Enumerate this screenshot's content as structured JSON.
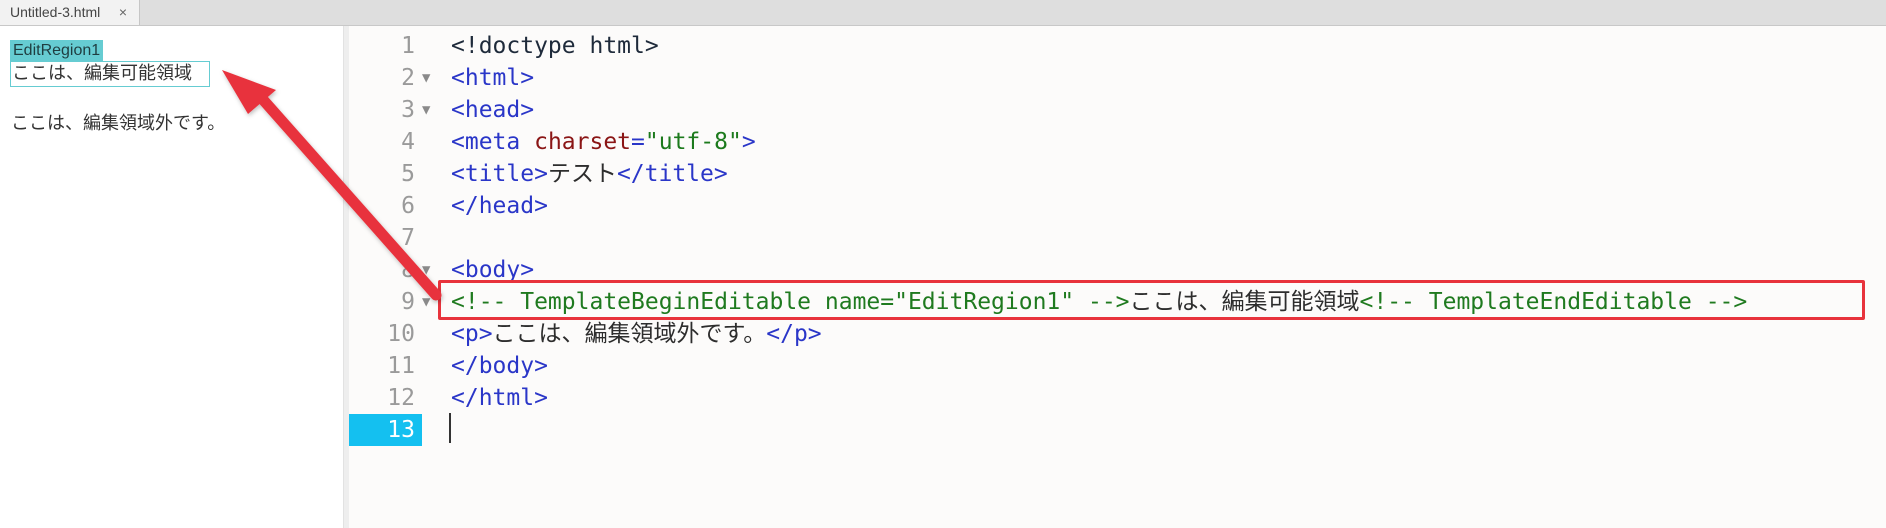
{
  "tabs": [
    {
      "label": "Untitled-3.html",
      "close": "×"
    }
  ],
  "design_view": {
    "editable_region_tag": "EditRegion1",
    "editable_region_content": "ここは、編集可能領域",
    "outside_paragraph": "ここは、編集領域外です。"
  },
  "code_view": {
    "lines": [
      {
        "num": "1",
        "segments": [
          {
            "t": "<!doctype html>",
            "c": "plain"
          }
        ]
      },
      {
        "num": "2",
        "fold": "▼",
        "segments": [
          {
            "t": "<html>",
            "c": "tag"
          }
        ]
      },
      {
        "num": "3",
        "fold": "▼",
        "segments": [
          {
            "t": "<head>",
            "c": "tag"
          }
        ]
      },
      {
        "num": "4",
        "segments": [
          {
            "t": "<meta ",
            "c": "tag"
          },
          {
            "t": "charset",
            "c": "attr"
          },
          {
            "t": "=",
            "c": "tag"
          },
          {
            "t": "\"utf-8\"",
            "c": "val"
          },
          {
            "t": ">",
            "c": "tag"
          }
        ]
      },
      {
        "num": "5",
        "segments": [
          {
            "t": "<title>",
            "c": "tag"
          },
          {
            "t": "テスト",
            "c": "txt"
          },
          {
            "t": "</title>",
            "c": "tag"
          }
        ]
      },
      {
        "num": "6",
        "segments": [
          {
            "t": "</head>",
            "c": "tag"
          }
        ]
      },
      {
        "num": "7",
        "segments": []
      },
      {
        "num": "8",
        "fold": "▼",
        "segments": [
          {
            "t": "<body>",
            "c": "tag"
          }
        ]
      },
      {
        "num": "9",
        "fold": "▼",
        "segments": [
          {
            "t": "<!-- TemplateBeginEditable name=\"EditRegion1\" -->",
            "c": "cmt"
          },
          {
            "t": "ここは、編集可能領域",
            "c": "txt"
          },
          {
            "t": "<!-- TemplateEndEditable -->",
            "c": "cmt"
          }
        ]
      },
      {
        "num": "10",
        "segments": [
          {
            "t": "<p>",
            "c": "tag"
          },
          {
            "t": "ここは、編集領域外です。",
            "c": "txt"
          },
          {
            "t": "</p>",
            "c": "tag"
          }
        ]
      },
      {
        "num": "11",
        "segments": [
          {
            "t": "</body>",
            "c": "tag"
          }
        ]
      },
      {
        "num": "12",
        "segments": [
          {
            "t": "</html>",
            "c": "tag"
          }
        ]
      },
      {
        "num": "13",
        "active": true,
        "segments": []
      }
    ]
  },
  "colors": {
    "highlight_box": "#e8333c",
    "arrow": "#e8333c",
    "editable_region_tag_bg": "#66ccd2",
    "active_line_bg": "#14c0f0"
  }
}
